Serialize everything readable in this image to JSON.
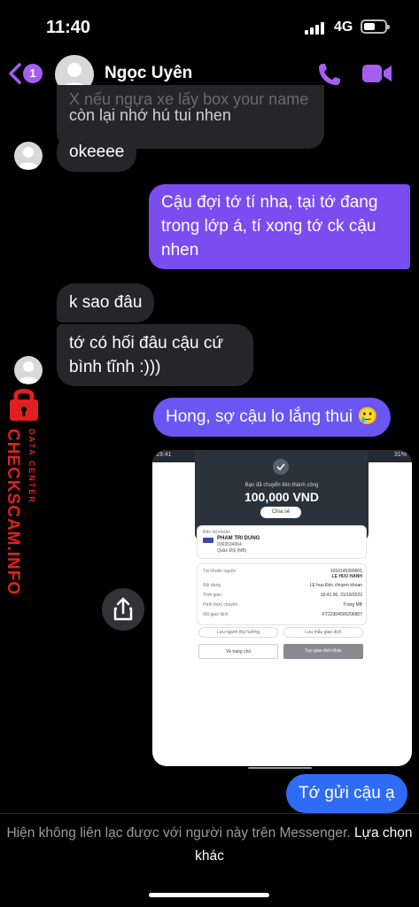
{
  "status_bar": {
    "time": "11:40",
    "network": "4G"
  },
  "header": {
    "unread_count": "1",
    "contact_name": "Ngọc Uyên"
  },
  "messages": {
    "top_partial_line1": "X nếu ngựa xe lấy box your name",
    "top_partial_line2": "còn lại nhớ hú tui nhen",
    "m1": "okeeee",
    "m2": "Cậu đợi tớ tí nha, tại tớ đang trong lớp á, tí xong tớ ck cậu nhen",
    "m3": "k sao đâu",
    "m4": "tớ có hối đâu cậu cứ bình tĩnh :)))",
    "m5": "Hong, sợ cậu lo lắng thui 🥲",
    "m6": "Tớ gửi cậu ạ"
  },
  "screenshot": {
    "time": "19:41",
    "battery": "31%",
    "subtitle": "Bạn đã chuyển tiền thành công",
    "amount": "100,000 VND",
    "share": "Chia sẻ",
    "recv_label": "Đến tài khoản",
    "recv_name": "PHAM TRI DUNG",
    "recv_account": "0369534064",
    "recv_bank": "Quân Đội (MB)",
    "rows": [
      {
        "label": "Tài khoản nguồn",
        "value": "1010145369001",
        "value2": "LE HUU HANH"
      },
      {
        "label": "Nội dung",
        "value": "LE huu Đức chuyen khoan"
      },
      {
        "label": "Thời gian",
        "value": "19:41:36, 31/10/2022"
      },
      {
        "label": "Hình thức chuyển",
        "value": "Trong MB"
      },
      {
        "label": "Mã giao dịch",
        "value": "FT22304500206907"
      }
    ],
    "save_receiver": "Lưu người thụ hưởng",
    "save_template": "Lưu mẫu giao dịch",
    "home": "Về trang chủ",
    "new_txn": "Tạo giao dịch khác"
  },
  "watermark": {
    "main": "CHECKSCAM.INFO",
    "sub": "DATA CENTER"
  },
  "footer": {
    "notice": "Hiện không liên lạc được với người này trên Messenger.",
    "link": "Lựa chọn khác"
  },
  "colors": {
    "accent": "#a55df2",
    "out_purple": "#7b4cf0",
    "out_blue": "#2f6cf6",
    "incoming": "#262628",
    "watermark": "#e0201f"
  }
}
